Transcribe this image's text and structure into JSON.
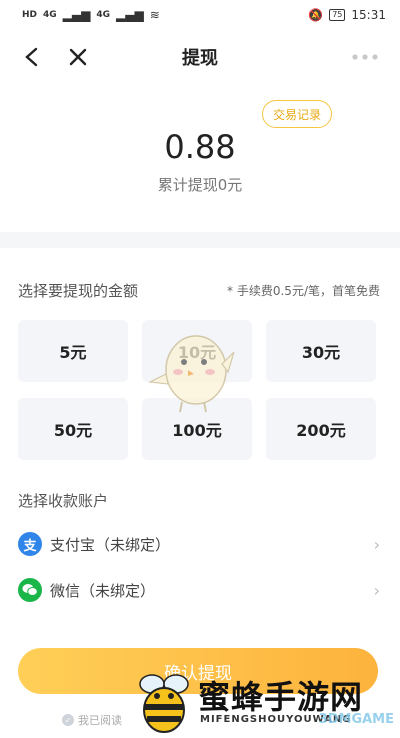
{
  "status_bar": {
    "network_left": "HD",
    "signal1": "4G",
    "signal2": "4G",
    "battery": "75",
    "time": "15:31"
  },
  "nav": {
    "title": "提现"
  },
  "summary": {
    "record_label": "交易记录",
    "amount": "0.88",
    "total_label": "累计提现0元"
  },
  "amount_section": {
    "title": "选择要提现的金额",
    "fee_note": "* 手续费0.5元/笔，首笔免费",
    "options": [
      "5元",
      "10元",
      "30元",
      "50元",
      "100元",
      "200元"
    ]
  },
  "account_section": {
    "title": "选择收款账户",
    "accounts": [
      {
        "label": "支付宝（未绑定）",
        "icon": "alipay-icon",
        "color": "#2f86e8"
      },
      {
        "label": "微信（未绑定）",
        "icon": "wechat-icon",
        "color": "#1ab64a"
      }
    ]
  },
  "confirm_label": "确认提现",
  "agreement_text": "我已阅读",
  "watermark": {
    "title": "蜜蜂手游网",
    "sub": "MIFENGSHOUYOUWANG",
    "brand": "3DMGAME"
  },
  "colors": {
    "accent": "#fdb33d",
    "record_border": "#f5c542"
  }
}
